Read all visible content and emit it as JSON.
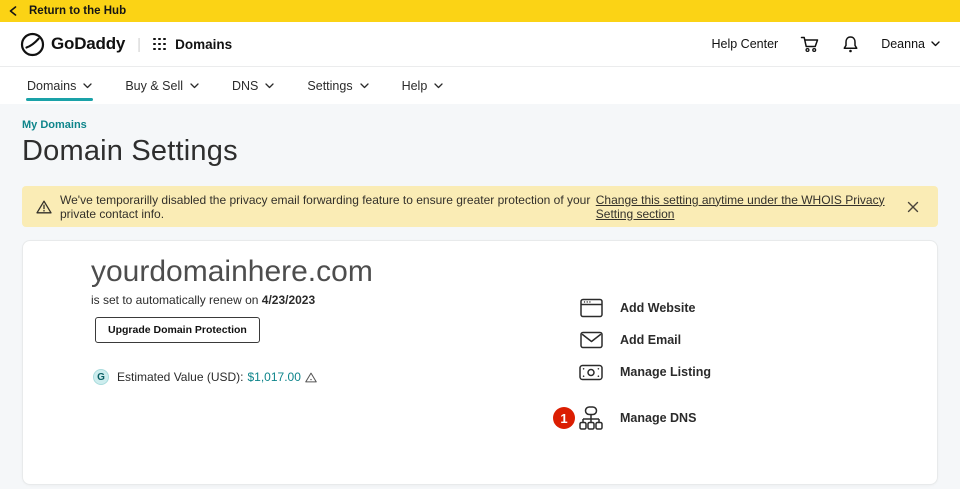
{
  "topbar": {
    "back_label": "Return to the Hub"
  },
  "header": {
    "brand": "GoDaddy",
    "divider": "|",
    "app_name": "Domains",
    "help_center": "Help Center",
    "user_name": "Deanna"
  },
  "nav": {
    "items": [
      {
        "label": "Domains",
        "active": true
      },
      {
        "label": "Buy & Sell",
        "active": false
      },
      {
        "label": "DNS",
        "active": false
      },
      {
        "label": "Settings",
        "active": false
      },
      {
        "label": "Help",
        "active": false
      }
    ]
  },
  "breadcrumb": "My Domains",
  "page_title": "Domain Settings",
  "alert": {
    "text": "We've temporarilly disabled the privacy email forwarding feature to ensure greater protection of your private contact info.",
    "link_text": "Change this setting anytime under the WHOIS Privacy Setting section"
  },
  "domain": {
    "name": "yourdomainhere.com",
    "renew_prefix": "is set to automatically renew on",
    "renew_date": "4/23/2023",
    "upgrade_button": "Upgrade Domain Protection",
    "value_badge": "G",
    "value_label": "Estimated Value (USD):",
    "value_amount": "$1,017.00"
  },
  "actions": [
    {
      "label": "Add Website",
      "icon": "browser-window-icon"
    },
    {
      "label": "Add Email",
      "icon": "envelope-icon"
    },
    {
      "label": "Manage Listing",
      "icon": "money-icon"
    },
    {
      "label": "Manage DNS",
      "icon": "sitemap-icon",
      "badge": "1"
    }
  ],
  "colors": {
    "brand_yellow": "#FBD315",
    "alert_yellow": "#FAECB5",
    "teal_link": "#0E858B",
    "nav_underline": "#1AA2A8",
    "badge_red": "#DB1E02"
  }
}
